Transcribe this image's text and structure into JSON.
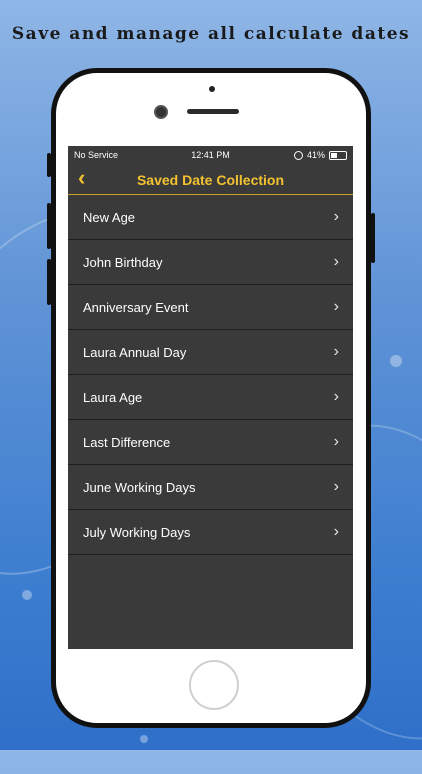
{
  "headline": "Save and manage all calculate dates",
  "status_bar": {
    "carrier": "No Service",
    "time": "12:41 PM",
    "battery": "41%",
    "battery_level": 0.41
  },
  "nav": {
    "back_icon": "chevron-left",
    "title": "Saved Date Collection",
    "accent_color": "#f2c230"
  },
  "items": [
    {
      "label": "New Age"
    },
    {
      "label": "John Birthday"
    },
    {
      "label": "Anniversary Event"
    },
    {
      "label": "Laura Annual Day"
    },
    {
      "label": "Laura Age"
    },
    {
      "label": "Last Difference"
    },
    {
      "label": "June Working Days"
    },
    {
      "label": "July Working Days"
    }
  ]
}
